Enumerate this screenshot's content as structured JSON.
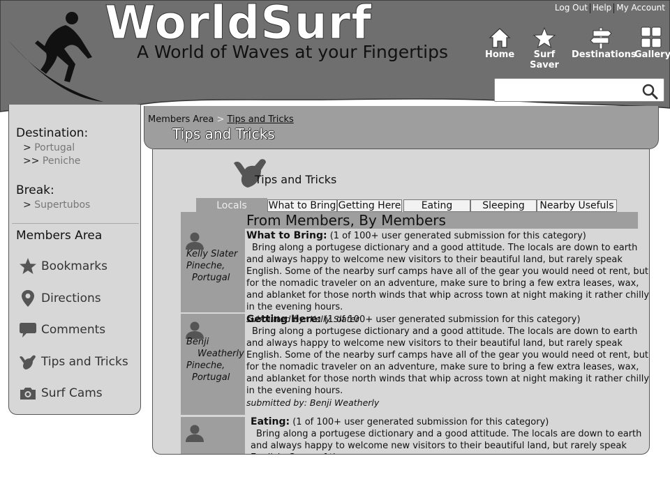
{
  "header": {
    "logo": "WorldSurf",
    "tagline": "A World of Waves at your Fingertips",
    "top_links": [
      "Log Out",
      "Help",
      "My Account"
    ],
    "nav": [
      {
        "label": "Home",
        "icon": "home-icon"
      },
      {
        "label": "Surf Saver",
        "icon": "star-icon"
      },
      {
        "label": "Destinations",
        "icon": "signpost-icon"
      },
      {
        "label": "Gallery",
        "icon": "grid-icon"
      }
    ],
    "search_value": ""
  },
  "sidebar": {
    "destination_label": "Destination:",
    "destination": [
      "Portugal",
      "Peniche"
    ],
    "destination_arrows": [
      ">",
      ">>"
    ],
    "break_label": "Break:",
    "break": "Supertubos",
    "break_arrow": ">",
    "members_label": "Members Area",
    "items": [
      {
        "label": "Bookmarks",
        "icon": "star-icon"
      },
      {
        "label": "Directions",
        "icon": "map-pin-icon"
      },
      {
        "label": "Comments",
        "icon": "speech-bubble-icon"
      },
      {
        "label": "Tips and Tricks",
        "icon": "shaka-hand-icon"
      },
      {
        "label": "Surf Cams",
        "icon": "camera-icon"
      }
    ]
  },
  "breadcrumb": {
    "root": "Members Area",
    "separator": ">",
    "current": "Tips and Tricks",
    "title": "Tips and Tricks"
  },
  "main": {
    "title": "Tips and Tricks",
    "tabs": [
      "Locals",
      "What to Bring",
      "Getting Here",
      "Eating",
      "Sleeping",
      "Nearby Usefuls"
    ],
    "active_tab": "Locals",
    "posts_header": "From Members, By Members",
    "posts": [
      {
        "author_lines": [
          "Kelly Slater",
          "Pineche,",
          "Portugal"
        ],
        "category": "What to Bring:",
        "meta": " (1 of 100+ user generated submission for this category)",
        "body": "Bring along a portugese dictionary and a good attitude. The locals are down to earth and always happy to welcome new visitors to their beautiful land, but rarely speak English. Some of the nearby surf camps have all of the gear you would need ot rent, but for the nomadic traveler on an adventure, make sure to bring a few extra leases, wax, and ablanket for those north winds that whip across town at night making it rather chilly in the evening hours.",
        "submitted_by": "submitted by: Kelly Slater"
      },
      {
        "author_lines": [
          "Benji",
          "Weatherly",
          "Pineche,",
          "Portugal"
        ],
        "category": "Getting Here:",
        "meta": " (1 of 100+ user generated submission for this category)",
        "body": "Bring along a portugese dictionary and a good attitude. The locals are down to earth and always happy to welcome new visitors to their beautiful land, but rarely speak English. Some of the nearby surf camps have all of the gear you would need ot rent, but for the nomadic traveler on an adventure, make sure to bring a few extra leases, wax, and ablanket for those north winds that whip across town at night making it rather chilly in the evening hours.",
        "submitted_by": "submitted by: Benji Weatherly"
      },
      {
        "author_lines": [],
        "category": "Eating:",
        "meta": " (1 of 100+ user generated submission for this category)",
        "body": "Bring along a portugese dictionary and a good attitude. The locals are down to earth and always happy to welcome new visitors to their beautiful land, but rarely speak English. Some of the near",
        "submitted_by": ""
      }
    ]
  },
  "colors": {
    "header_bg": "#6f6f6f",
    "panel_bg": "#d7d7d7",
    "accent_gray": "#9e9e9e",
    "link_gray": "#777777"
  }
}
